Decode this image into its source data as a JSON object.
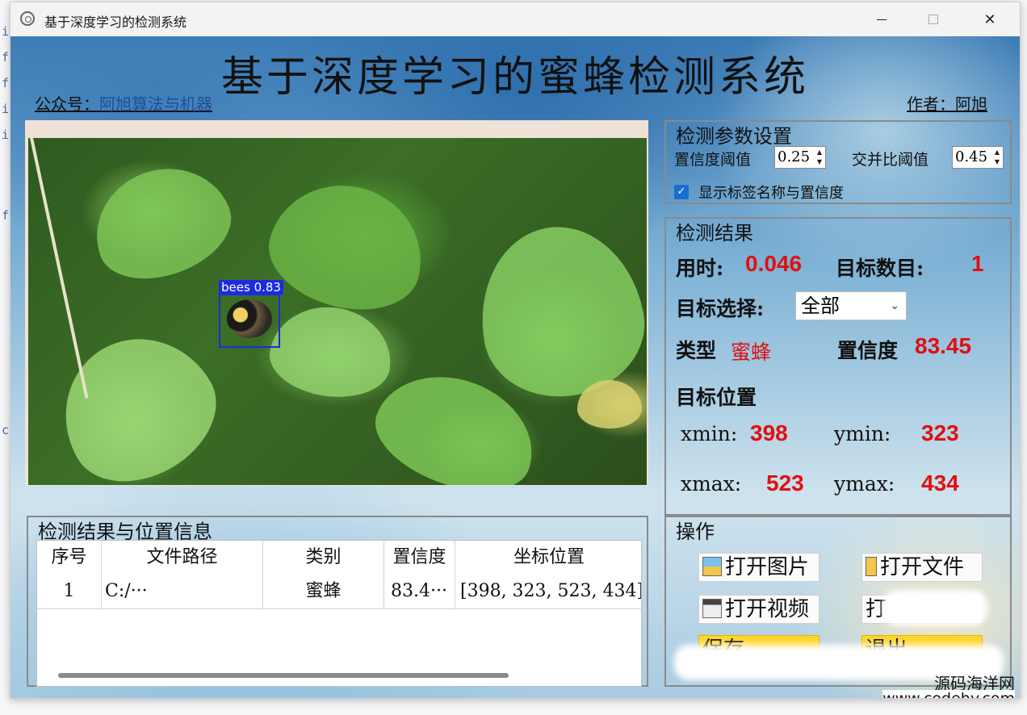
{
  "window": {
    "title": "基于深度学习的检测系统"
  },
  "header": {
    "main_title": "基于深度学习的蜜蜂检测系统",
    "wechat_label": "公众号：",
    "wechat_value": "阿旭算法与机器",
    "author_label": "作者：",
    "author_value": "阿旭"
  },
  "detection": {
    "label": "bees",
    "score": "0.83"
  },
  "params": {
    "title": "检测参数设置",
    "conf_label": "置信度阈值",
    "conf_value": "0.25",
    "iou_label": "交并比阈值",
    "iou_value": "0.45",
    "show_label_text": "显示标签名称与置信度",
    "show_label_checked": true
  },
  "results": {
    "title": "检测结果",
    "time_label": "用时:",
    "time_value": "0.046",
    "count_label": "目标数目:",
    "count_value": "1",
    "select_label": "目标选择:",
    "select_value": "全部",
    "type_label": "类型",
    "type_value": "蜜蜂",
    "conf_label": "置信度",
    "conf_value": "83.45",
    "position_title": "目标位置",
    "xmin_label": "xmin:",
    "xmin_value": "398",
    "ymin_label": "ymin:",
    "ymin_value": "323",
    "xmax_label": "xmax:",
    "xmax_value": "523",
    "ymax_label": "ymax:",
    "ymax_value": "434"
  },
  "table": {
    "title": "检测结果与位置信息",
    "columns": [
      "序号",
      "文件路径",
      "类别",
      "置信度",
      "坐标位置"
    ],
    "rows": [
      [
        "1",
        "C:/···",
        "蜜蜂",
        "83.4···",
        "[398, 323, 523, 434]"
      ]
    ]
  },
  "operations": {
    "title": "操作",
    "open_image": "打开图片",
    "open_folder": "打开文件",
    "open_video": "打开视频",
    "open_camera": "打",
    "save": "保存",
    "exit": "退出"
  },
  "watermark": {
    "line1": "源码海洋网",
    "line2": "www.codehy.com"
  },
  "colors": {
    "accent_red": "#e01010",
    "bbox_blue": "#1c2be0",
    "check_blue": "#1a6fce"
  }
}
